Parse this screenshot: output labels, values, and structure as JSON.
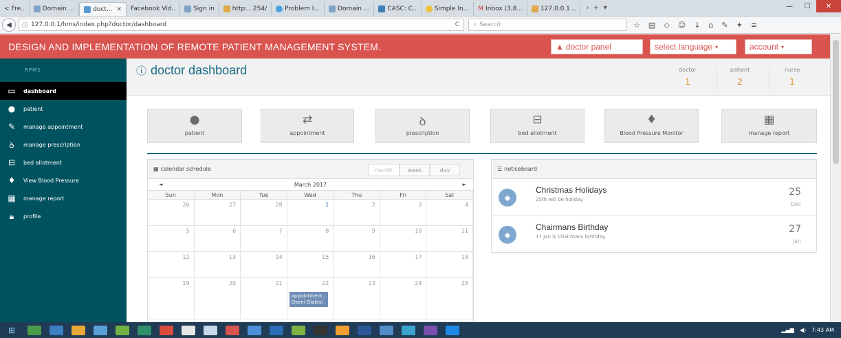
{
  "browser": {
    "tabs": [
      {
        "label": "Fre.."
      },
      {
        "label": "Domain ..."
      },
      {
        "label": "doct...",
        "active": true
      },
      {
        "label": "Facebook Vid.."
      },
      {
        "label": "Sign in"
      },
      {
        "label": "http:...254/"
      },
      {
        "label": "Problem I..."
      },
      {
        "label": "Domain ..."
      },
      {
        "label": "CASC: C.."
      },
      {
        "label": "Simple In..."
      },
      {
        "label": "Inbox (3,8..."
      },
      {
        "label": "127.0.0.1..."
      }
    ],
    "url": "127.0.0.1/hms/index.php?doctor/dashboard",
    "search_placeholder": "Search"
  },
  "app": {
    "title": "DESIGN AND IMPLEMENTATION OF REMOTE PATIENT MANAGEMENT SYSTEM.",
    "doctor_panel": "doctor panel",
    "select_language": "select language",
    "account": "account",
    "accent": "#d9534f",
    "sidebar_color": "#00525f"
  },
  "sidebar": {
    "brand": "RPMS",
    "items": [
      {
        "label": "dashboard",
        "icon": "monitor-icon"
      },
      {
        "label": "patient",
        "icon": "user-icon"
      },
      {
        "label": "manage appointment",
        "icon": "edit-icon"
      },
      {
        "label": "manage prescription",
        "icon": "stethoscope-icon"
      },
      {
        "label": "bed allotment",
        "icon": "hdd-icon"
      },
      {
        "label": "View Blood Pressure",
        "icon": "drop-icon"
      },
      {
        "label": "manage report",
        "icon": "building-icon"
      },
      {
        "label": "profile",
        "icon": "lock-icon"
      }
    ]
  },
  "page": {
    "title": "doctor dashboard",
    "counters": [
      {
        "label": "doctor",
        "value": "1"
      },
      {
        "label": "patient",
        "value": "2"
      },
      {
        "label": "nurse",
        "value": "1"
      }
    ],
    "tiles": [
      {
        "label": "patient",
        "icon": "user-icon"
      },
      {
        "label": "appointment",
        "icon": "exchange-icon"
      },
      {
        "label": "prescription",
        "icon": "stethoscope-icon"
      },
      {
        "label": "bed allotment",
        "icon": "hdd-icon"
      },
      {
        "label": "Blood Pressure Monitor",
        "icon": "drop-icon"
      },
      {
        "label": "manage report",
        "icon": "building-icon"
      }
    ]
  },
  "calendar": {
    "header": "calendar schedule",
    "views": [
      "month",
      "week",
      "day"
    ],
    "month": "March 2017",
    "days": [
      "Sun",
      "Mon",
      "Tue",
      "Wed",
      "Thu",
      "Fri",
      "Sat"
    ],
    "weeks": [
      [
        "26",
        "27",
        "28",
        "1",
        "2",
        "3",
        "4"
      ],
      [
        "5",
        "6",
        "7",
        "8",
        "9",
        "10",
        "11"
      ],
      [
        "12",
        "13",
        "14",
        "15",
        "16",
        "17",
        "18"
      ],
      [
        "19",
        "20",
        "21",
        "22",
        "23",
        "24",
        "25"
      ]
    ],
    "event": "appointment : Oseni Olabisi"
  },
  "noticeboard": {
    "header": "noticeboard",
    "items": [
      {
        "title": "Christmas Holidays",
        "desc": "25th will be holiday.",
        "day": "25",
        "month": "Dec"
      },
      {
        "title": "Chairmans Birthday",
        "desc": "17 Jan is Chairmans birthday.",
        "day": "27",
        "month": "jan"
      }
    ]
  },
  "taskbar": {
    "time": "7:43 AM"
  }
}
